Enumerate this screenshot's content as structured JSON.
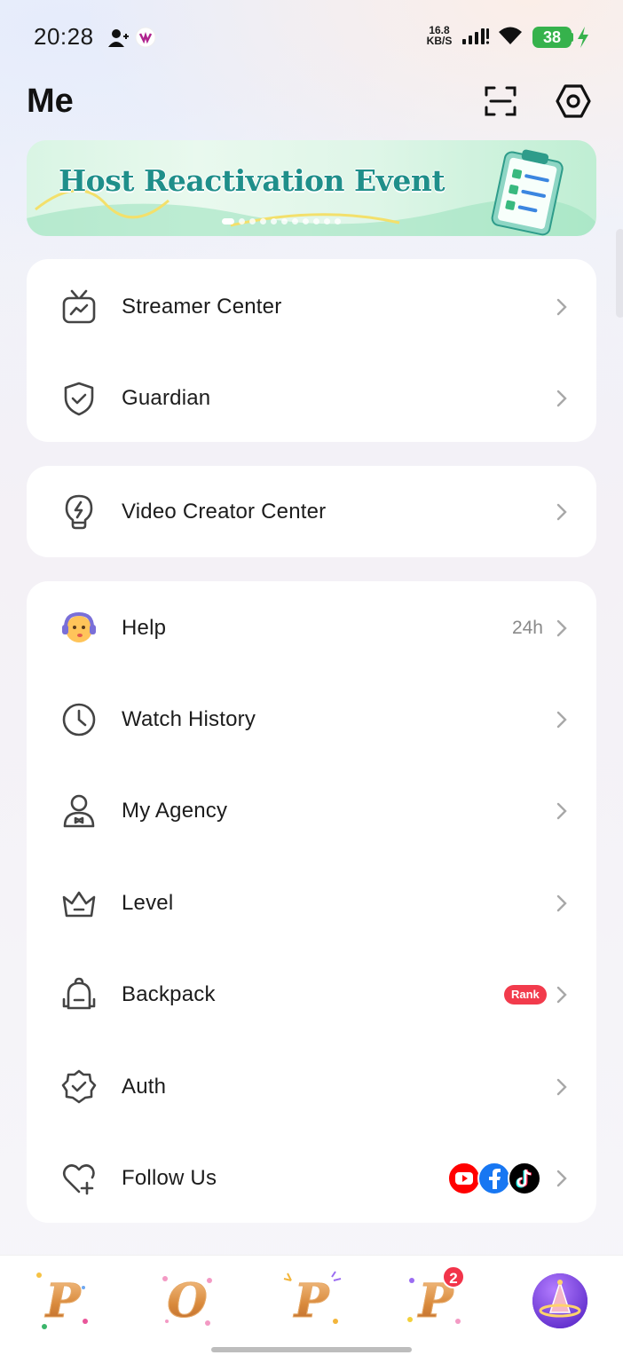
{
  "status_bar": {
    "time": "20:28",
    "net_speed_value": "16.8",
    "net_speed_unit": "KB/S",
    "battery": "38"
  },
  "header": {
    "title": "Me"
  },
  "banner": {
    "title": "Host Reactivation Event"
  },
  "card1": {
    "items": [
      {
        "label": "Streamer Center",
        "icon": "tv-icon"
      },
      {
        "label": "Guardian",
        "icon": "shield-check-icon"
      }
    ]
  },
  "card2": {
    "items": [
      {
        "label": "Video Creator Center",
        "icon": "bulb-bolt-icon"
      }
    ]
  },
  "card3": {
    "items": [
      {
        "label": "Help",
        "icon": "support-agent-icon",
        "extra": "24h"
      },
      {
        "label": "Watch History",
        "icon": "clock-icon"
      },
      {
        "label": "My Agency",
        "icon": "agent-person-icon",
        "badge": "Rank"
      },
      {
        "label": "Level",
        "icon": "crown-icon"
      },
      {
        "label": "Backpack",
        "icon": "backpack-icon"
      },
      {
        "label": "Auth",
        "icon": "verified-badge-icon"
      },
      {
        "label": "Follow Us",
        "icon": "heart-plus-icon"
      }
    ]
  },
  "bottom_nav": {
    "items": [
      {
        "glyph": "P"
      },
      {
        "glyph": "O"
      },
      {
        "glyph": "P"
      },
      {
        "glyph": "P"
      },
      {
        "glyph": ""
      }
    ],
    "badge_count": "2"
  },
  "colors": {
    "accent_green": "#36b24c",
    "badge_red": "#f23b4c",
    "banner_teal": "#1f8f8a"
  }
}
